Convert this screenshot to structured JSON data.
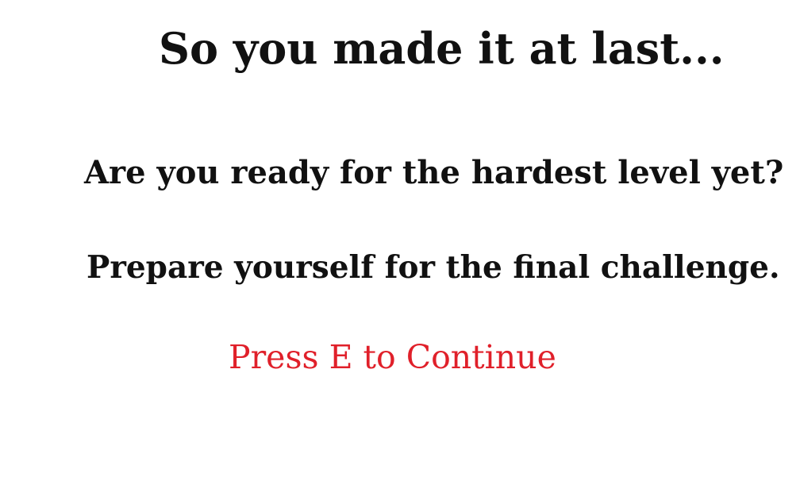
{
  "colors": {
    "background": "#ffffff",
    "text": "#111111",
    "prompt": "#e0202a"
  },
  "screen": {
    "title": "So you made it at last...",
    "message_line_1": "Are you ready for the hardest level yet?",
    "message_line_2": "Prepare yourself for the final challenge.",
    "continue_prompt": "Press E to Continue"
  }
}
